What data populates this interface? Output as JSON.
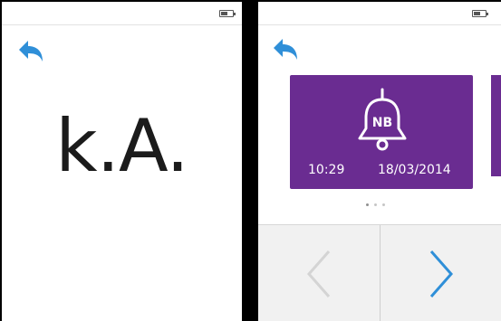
{
  "left_screen": {
    "battery_level": 0.5,
    "status_text": "k.A."
  },
  "right_screen": {
    "battery_level": 0.5,
    "card": {
      "badge": "NB",
      "time": "10:29",
      "date": "18/03/2014",
      "color": "#6a2c91"
    },
    "pager": {
      "total": 3,
      "active": 1
    },
    "nav": {
      "prev_enabled": false,
      "next_enabled": true
    },
    "accent_color": "#2f8fd8"
  }
}
